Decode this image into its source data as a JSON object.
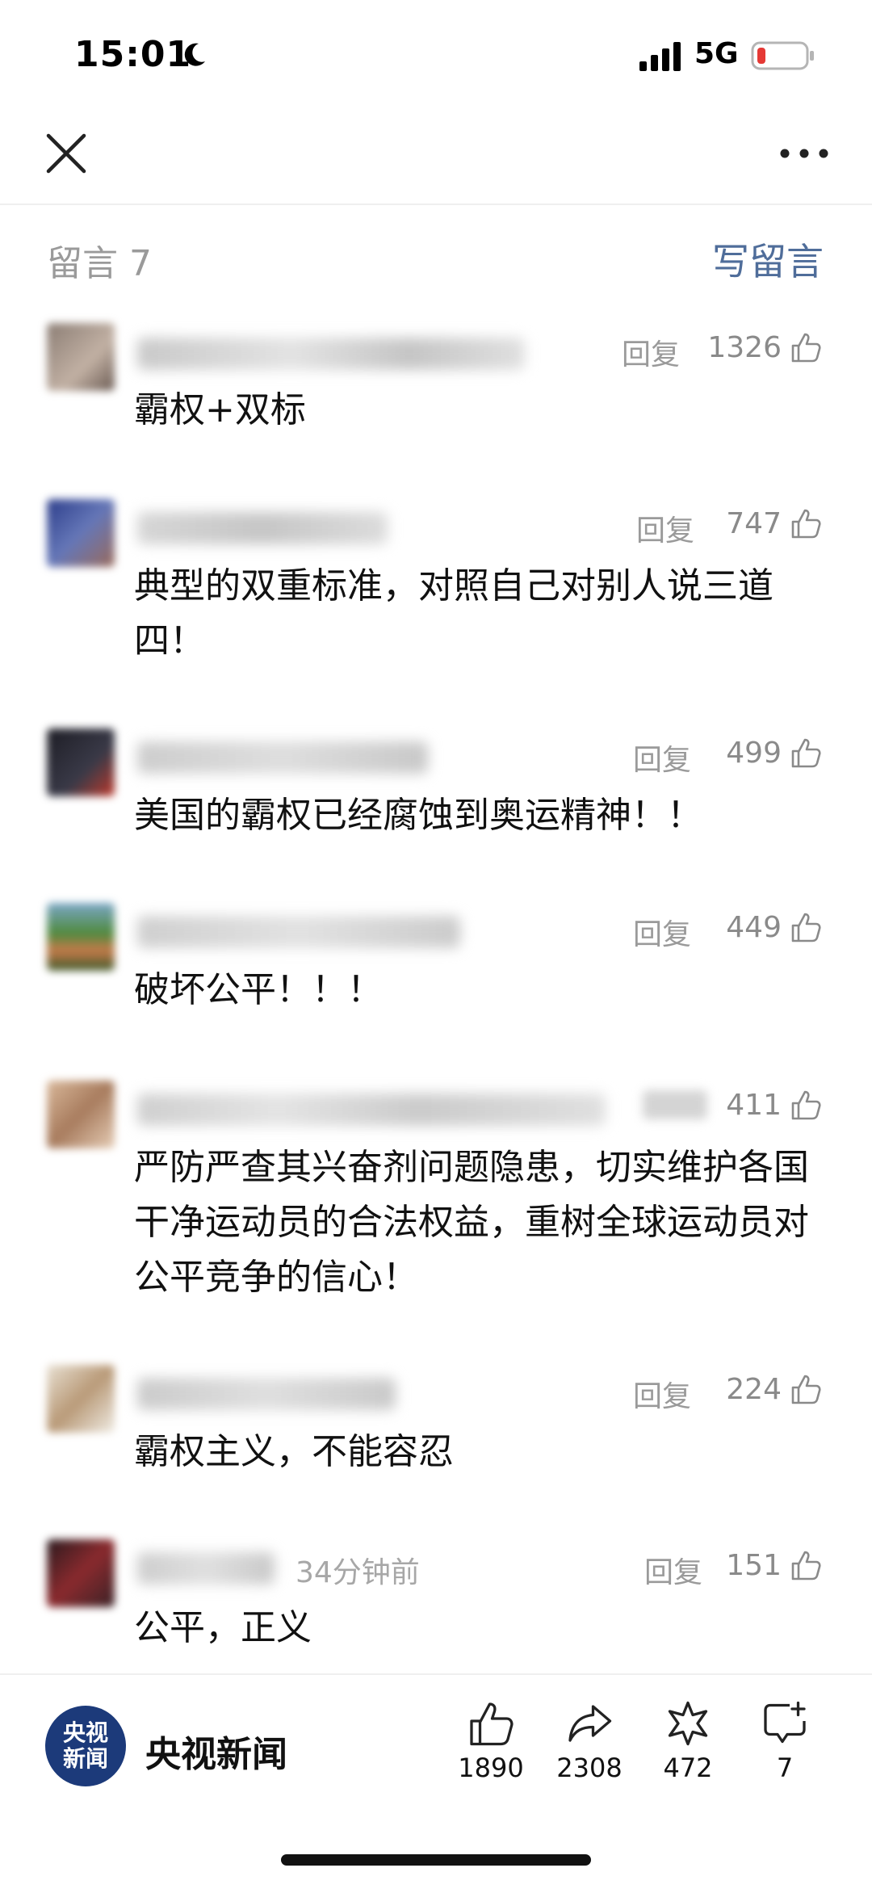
{
  "status": {
    "time": "15:01",
    "network": "5G"
  },
  "comments_header": {
    "count_label": "留言 7",
    "write_label": "写留言"
  },
  "comments": [
    {
      "time": "",
      "reply": "回复",
      "likes": "1326",
      "text": "霸权+双标"
    },
    {
      "time": "",
      "reply": "回复",
      "likes": "747",
      "text": "典型的双重标准，对照自己对别人说三道四！"
    },
    {
      "time": "",
      "reply": "回复",
      "likes": "499",
      "text": "美国的霸权已经腐蚀到奥运精神！！"
    },
    {
      "time": "",
      "reply": "回复",
      "likes": "449",
      "text": "破坏公平！！！"
    },
    {
      "time": "",
      "reply": "",
      "likes": "411",
      "text": "严防严查其兴奋剂问题隐患，切实维护各国干净运动员的合法权益，重树全球运动员对公平竞争的信心！"
    },
    {
      "time": "",
      "reply": "回复",
      "likes": "224",
      "text": "霸权主义，不能容忍"
    },
    {
      "time": "34分钟前",
      "reply": "回复",
      "likes": "151",
      "text": "公平，正义"
    }
  ],
  "footer": {
    "logo_text": "央视新闻",
    "brand": "央视新闻",
    "actions": [
      {
        "icon": "thumbs-up-icon",
        "count": "1890"
      },
      {
        "icon": "share-icon",
        "count": "2308"
      },
      {
        "icon": "star-icon",
        "count": "472"
      },
      {
        "icon": "comment-add-icon",
        "count": "7"
      }
    ]
  },
  "colors": {
    "accent": "#4f6d9a",
    "muted": "#9a9a9a",
    "logo_bg": "#1c3a7a",
    "battery_low": "#e53935"
  }
}
